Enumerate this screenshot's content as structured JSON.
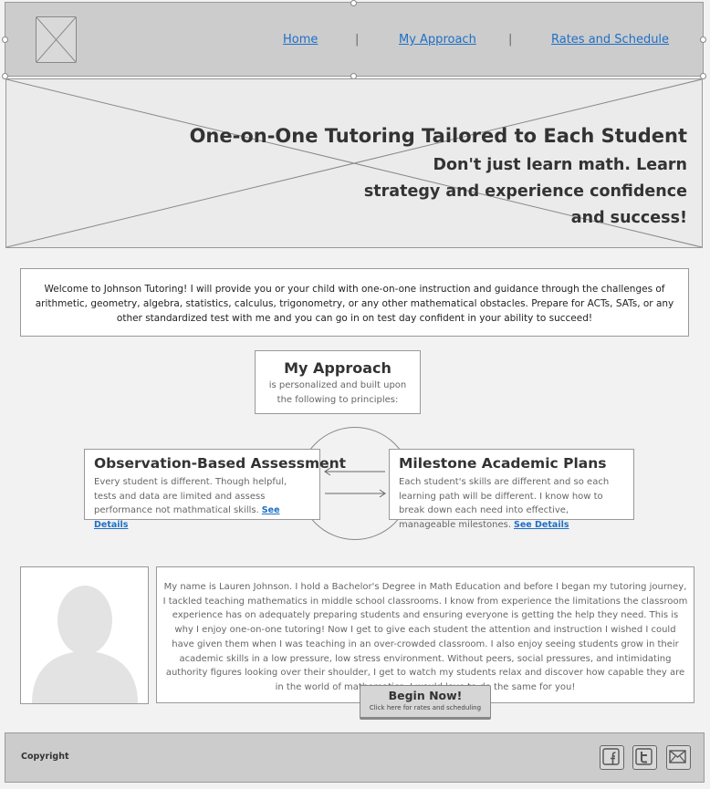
{
  "nav": {
    "items": [
      {
        "label": "Home"
      },
      {
        "label": "My Approach"
      },
      {
        "label": "Rates and Schedule"
      }
    ],
    "separator": "|"
  },
  "hero": {
    "title": "One-on-One Tutoring Tailored to Each Student",
    "subtitle": "Don't just learn math. Learn strategy and experience confidence and success!"
  },
  "intro": {
    "text": "Welcome to Johnson Tutoring! I will provide you or your child with one-on-one instruction and guidance through the challenges of arithmetic, geometry, algebra, statistics, calculus, trigonometry, or any other mathematical obstacles. Prepare for ACTs, SATs, or any other standardized test with me and you can go in on test day confident in your ability to succeed!"
  },
  "approach": {
    "title": "My Approach",
    "text": "is personalized and built upon the following to principles:"
  },
  "principles": [
    {
      "title": "Observation-Based Assessment",
      "text": "Every student is different. Though helpful, tests and data are limited and assess performance not mathmatical skills.",
      "link": "See Details"
    },
    {
      "title": "Milestone Academic Plans",
      "text": "Each student's skills are different and so each learning path will be different. I know how to break down each need into effective, manageable milestones.",
      "link": "See Details"
    }
  ],
  "bio": {
    "text": "My name is Lauren Johnson. I hold a Bachelor's Degree in Math Education and before I began my tutoring journey, I tackled teaching mathematics in middle school classrooms. I know from experience the limitations the classroom experience has on adequately preparing students and ensuring everyone is getting the help they need. This is why I enjoy one-on-one tutoring! Now I get to give each student the attention and instruction I wished I could have given them when I was teaching in an over-crowded classroom. I also enjoy seeing students grow in their academic skills in a low pressure, low stress environment. Without peers, social pressures, and intimidating authority figures looking over their shoulder, I get to watch my students relax and discover how capable they are in the world of mathematics. I would love to do the same for you!"
  },
  "cta": {
    "title": "Begin Now!",
    "subtitle": "Click here for rates and scheduling"
  },
  "footer": {
    "copyright": "Copyright",
    "social_icons": [
      "facebook-icon",
      "twitter-icon",
      "email-icon"
    ]
  }
}
